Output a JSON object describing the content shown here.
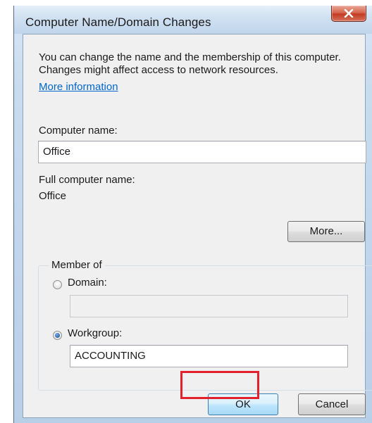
{
  "dialog": {
    "title": "Computer Name/Domain Changes",
    "description": "You can change the name and the membership of this computer. Changes might affect access to network resources.",
    "more_info_link": "More information",
    "computer_name_label": "Computer name:",
    "computer_name_value": "Office",
    "full_name_label": "Full computer name:",
    "full_name_value": "Office",
    "more_button": "More...",
    "member_of": {
      "legend": "Member of",
      "domain_label": "Domain:",
      "domain_value": "",
      "domain_selected": false,
      "workgroup_label": "Workgroup:",
      "workgroup_value": "ACCOUNTING",
      "workgroup_selected": true
    },
    "ok_button": "OK",
    "cancel_button": "Cancel"
  },
  "colors": {
    "link": "#0066cc",
    "highlight": "#e3212d",
    "close_button": "#c23a22"
  },
  "icons": {
    "close": "close-icon"
  }
}
